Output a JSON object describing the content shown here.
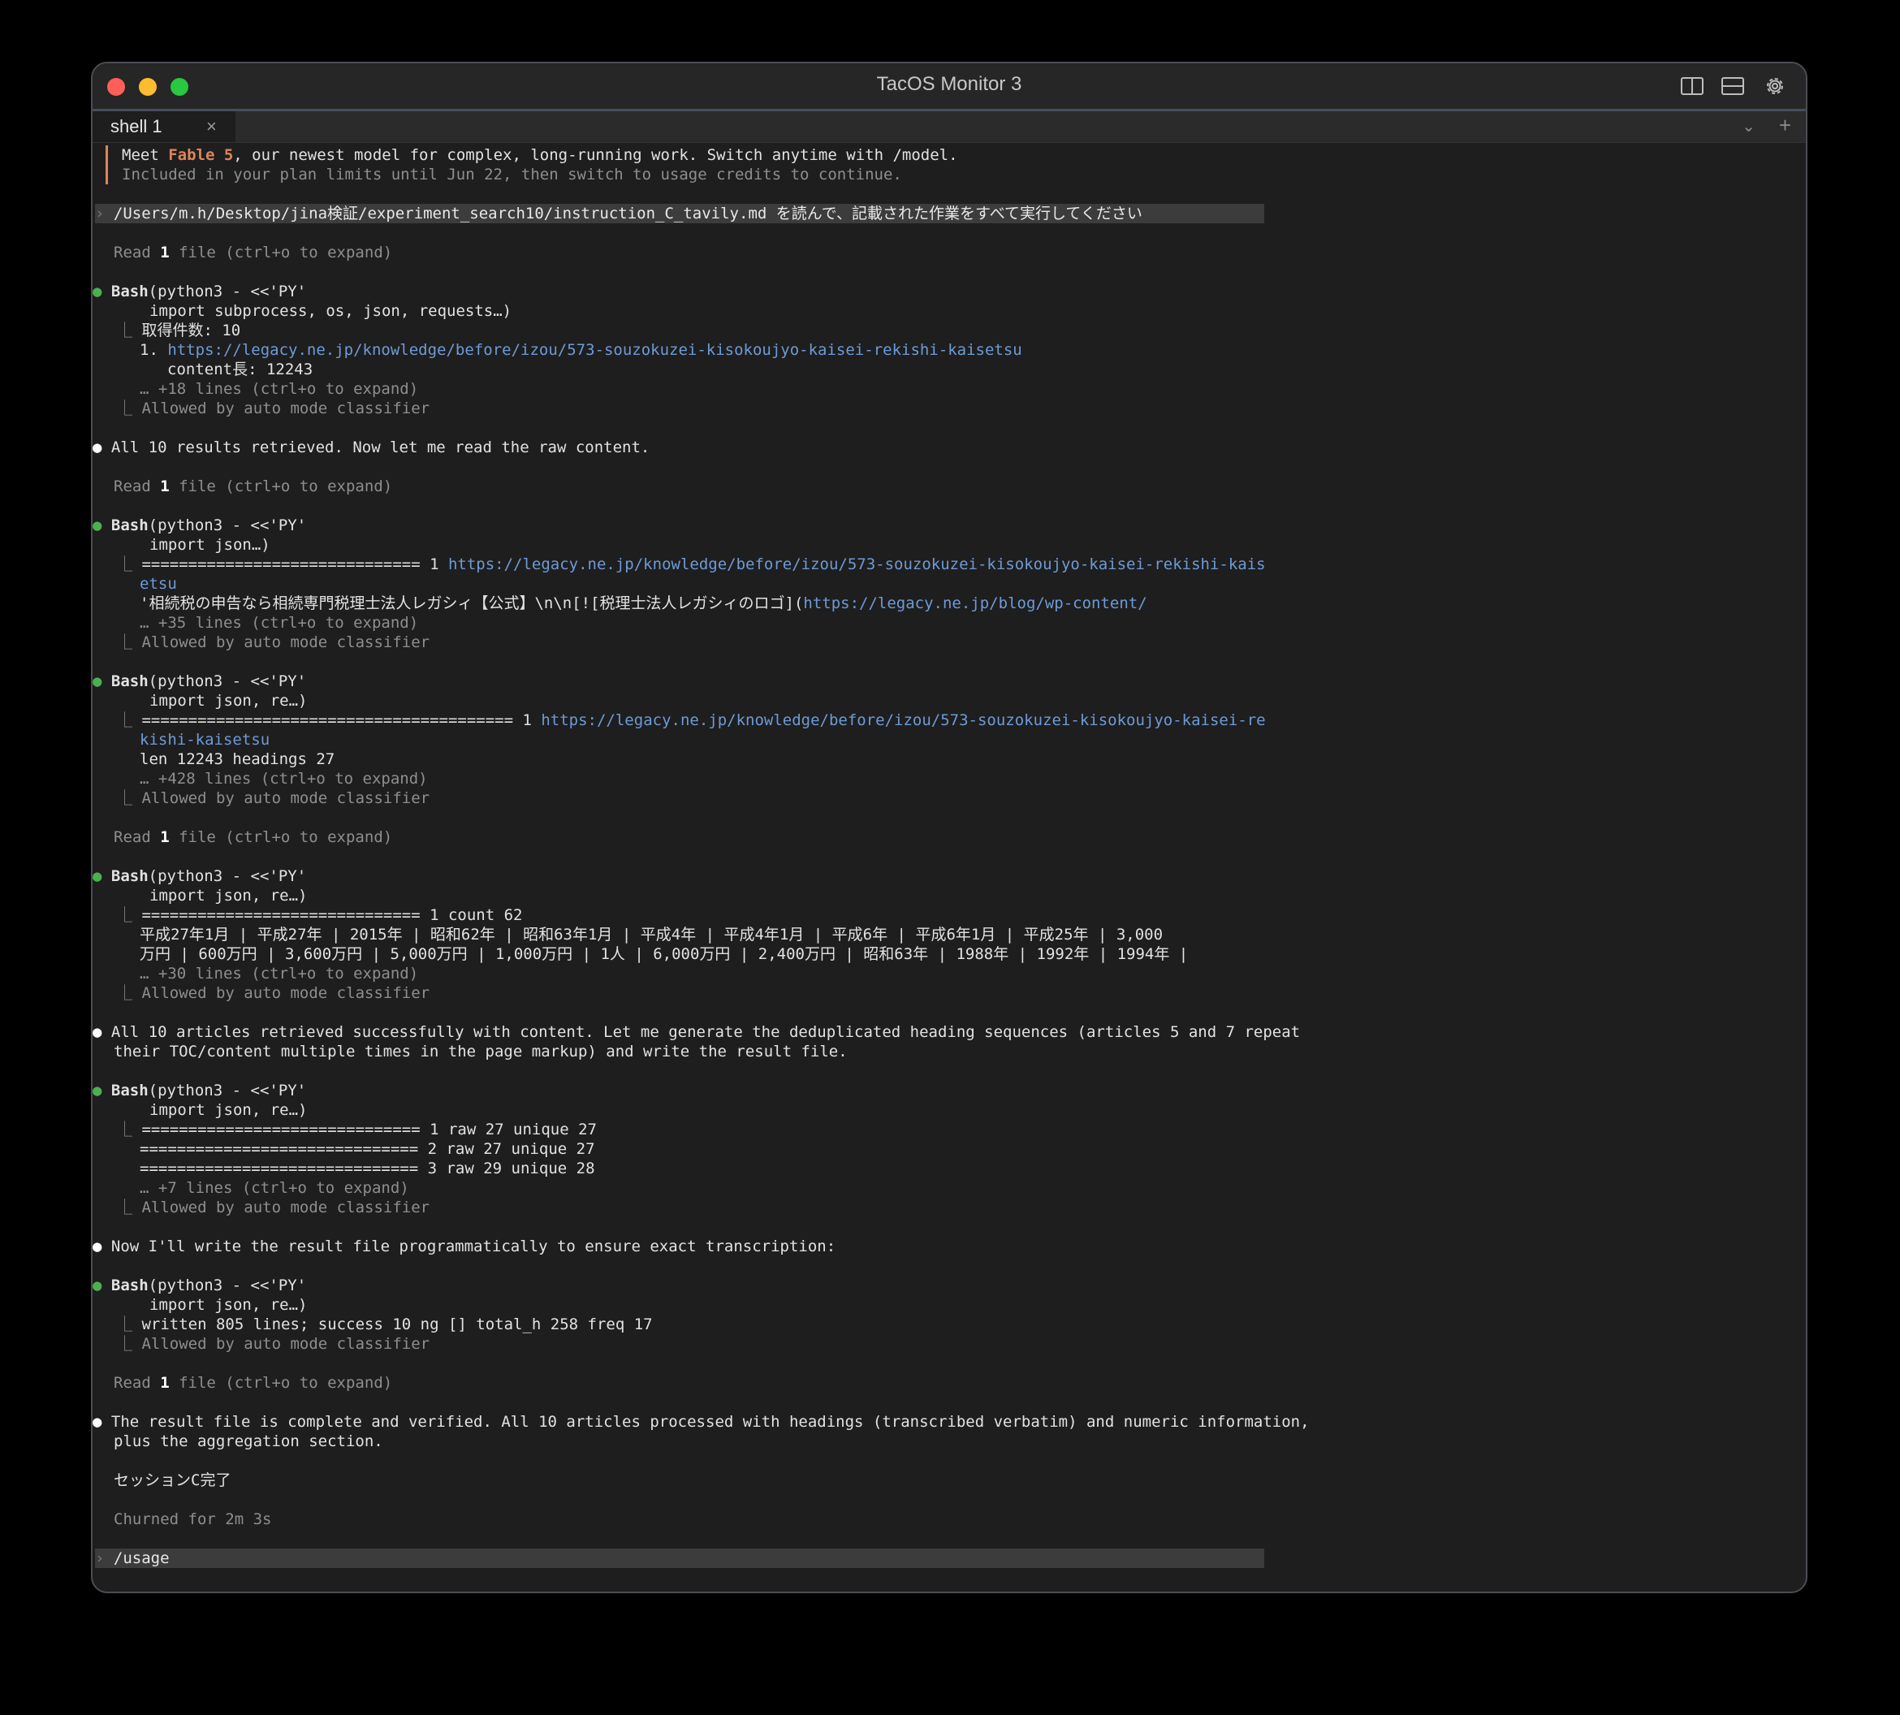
{
  "window": {
    "title": "TacOS Monitor 3"
  },
  "tabs": [
    {
      "label": "shell 1",
      "close": "×"
    }
  ],
  "tabbar": {
    "chevron": "⌄",
    "plus": "+"
  },
  "banner": {
    "line1_pre": "Meet ",
    "line1_model": "Fable 5",
    "line1_post": ", our newest model for complex, long-running work. Switch anytime with /model.",
    "line2": "Included in your plan limits until Jun 22, then switch to usage credits to continue."
  },
  "prompt_symbol": "›",
  "user_prompt": "/Users/m.h/Desktop/jina検証/experiment_search10/instruction_C_tavily.md を読んで、記載された作業をすべて実行してください",
  "read1": {
    "pre": "Read ",
    "num": "1",
    "post": " file (ctrl+o to expand)"
  },
  "dot": "●",
  "bash_label": "Bash",
  "bash_head": "(python3 - <<'PY'",
  "branch": "⎿",
  "allowed": "Allowed by auto mode classifier",
  "b1": {
    "l2": "import subprocess, os, json, requests…)",
    "o1": "取得件数: 10",
    "o2_pre": "1. ",
    "o2_link": "https://legacy.ne.jp/knowledge/before/izou/573-souzokuzei-kisokoujyo-kaisei-rekishi-kaisetsu",
    "o3": "content長: 12243",
    "o4": "… +18 lines (ctrl+o to expand)"
  },
  "m1": "All 10 results retrieved. Now let me read the raw content.",
  "b2": {
    "l2": "import json…)",
    "o1_pre": "============================== 1 ",
    "o1_link": "https://legacy.ne.jp/knowledge/before/izou/573-souzokuzei-kisokoujyo-kaisei-rekishi-kais",
    "o1_cont": "etsu",
    "o2_pre": "'相続税の申告なら相続専門税理士法人レガシィ【公式】\\n\\n[![税理士法人レガシィのロゴ](",
    "o2_link": "https://legacy.ne.jp/blog/wp-content/",
    "o3": "… +35 lines (ctrl+o to expand)"
  },
  "b3": {
    "l2": "import json, re…)",
    "o1_pre": "======================================== 1 ",
    "o1_link": "https://legacy.ne.jp/knowledge/before/izou/573-souzokuzei-kisokoujyo-kaisei-re",
    "o1_cont": "kishi-kaisetsu",
    "o2": "len 12243 headings 27",
    "o3": "… +428 lines (ctrl+o to expand)"
  },
  "b4": {
    "l2": "import json, re…)",
    "o1": "============================== 1 count 62",
    "o2": "平成27年1月 | 平成27年 | 2015年 | 昭和62年 | 昭和63年1月 | 平成4年 | 平成4年1月 | 平成6年 | 平成6年1月 | 平成25年 | 3,000",
    "o3": "万円 | 600万円 | 3,600万円 | 5,000万円 | 1,000万円 | 1人 | 6,000万円 | 2,400万円 | 昭和63年 | 1988年 | 1992年 | 1994年 |",
    "o4": "… +30 lines (ctrl+o to expand)"
  },
  "m2": {
    "l1": "All 10 articles retrieved successfully with content. Let me generate the deduplicated heading sequences (articles 5 and 7 repeat",
    "l2": "their TOC/content multiple times in the page markup) and write the result file."
  },
  "b5": {
    "l2": "import json, re…)",
    "o1": "============================== 1 raw 27 unique 27",
    "o2": "============================== 2 raw 27 unique 27",
    "o3": "============================== 3 raw 29 unique 28",
    "o4": "… +7 lines (ctrl+o to expand)"
  },
  "m3": "Now I'll write the result file programmatically to ensure exact transcription:",
  "b6": {
    "l2": "import json, re…)",
    "o1": "written 805 lines; success 10 ng [] total_h 258 freq 17"
  },
  "m4": {
    "l1": "The result file is complete and verified. All 10 articles processed with headings (transcribed verbatim) and numeric information,",
    "l2": "plus the aggregation section."
  },
  "done": "セッションC完了",
  "churned": "Churned for 2m 3s",
  "usage_cmd": "/usage"
}
